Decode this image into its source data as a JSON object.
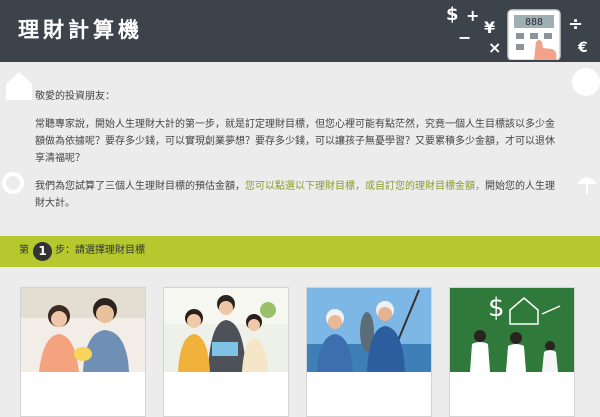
{
  "header": {
    "title": "理財計算機",
    "icon_symbols": [
      "$",
      "+",
      "÷",
      "×",
      "−",
      "¥",
      "€"
    ]
  },
  "calculator": {
    "display": "888"
  },
  "intro": {
    "greeting": "敬愛的投資朋友：",
    "paragraph1": "常聽專家說，開始人生理財大計的第一步，就是訂定理財目標，但您心裡可能有點茫然，究竟一個人生目標該以多少金額做為依據呢？要存多少錢，可以實現創業夢想？要存多少錢，可以讓孩子無憂學習？又要累積多少金額，才可以退休享清福呢？",
    "paragraph2_a": "我們為您試算了三個人生理財目標的預估金額，",
    "paragraph2_b": "您可以點選以下理財目標，或自訂您的理財目標金額，",
    "paragraph2_c": "開始您的人生理財大計。"
  },
  "step": {
    "prefix": "第",
    "number": "1",
    "suffix": "步：請選擇理財目標"
  },
  "cards": [
    {
      "icon": "couple-savings-photo"
    },
    {
      "icon": "family-reading-photo"
    },
    {
      "icon": "retirement-fishing-photo"
    },
    {
      "icon": "chalkboard-custom-goal-photo"
    }
  ],
  "colors": {
    "header_bg": "#3d434b",
    "accent": "#b5c92f",
    "highlight_text": "#8a9a2a",
    "page_bg": "#ececec"
  }
}
